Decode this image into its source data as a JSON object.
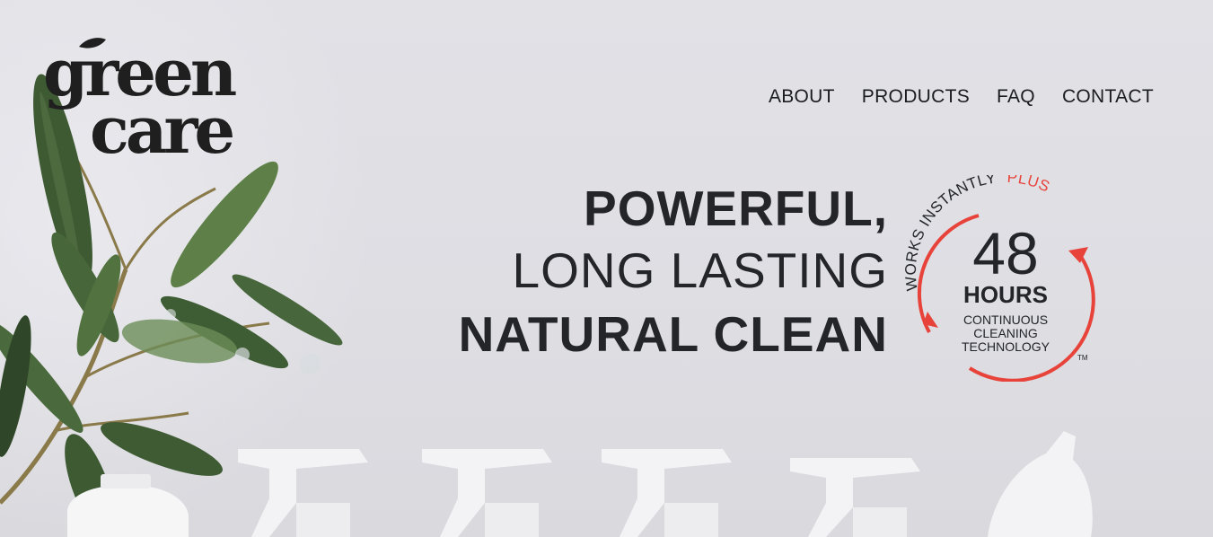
{
  "brand": {
    "logo_line1": "green",
    "logo_line2": "care",
    "logo_color": "#1f1f1f"
  },
  "nav": {
    "items": [
      {
        "label": "ABOUT"
      },
      {
        "label": "PRODUCTS"
      },
      {
        "label": "FAQ"
      },
      {
        "label": "CONTACT"
      }
    ]
  },
  "hero": {
    "line1": "POWERFUL,",
    "line2": "LONG LASTING",
    "line3": "NATURAL CLEAN"
  },
  "badge": {
    "arc_text": "WORKS INSTANTLY",
    "arc_accent": "PLUS",
    "number": "48",
    "unit": "HOURS",
    "line1": "CONTINUOUS",
    "line2": "CLEANING",
    "line3": "TECHNOLOGY",
    "trademark": "TM",
    "accent_color": "#e8433a"
  },
  "colors": {
    "background": "#dfdfe4",
    "text": "#232529",
    "leaf": "#4c6b3c"
  }
}
